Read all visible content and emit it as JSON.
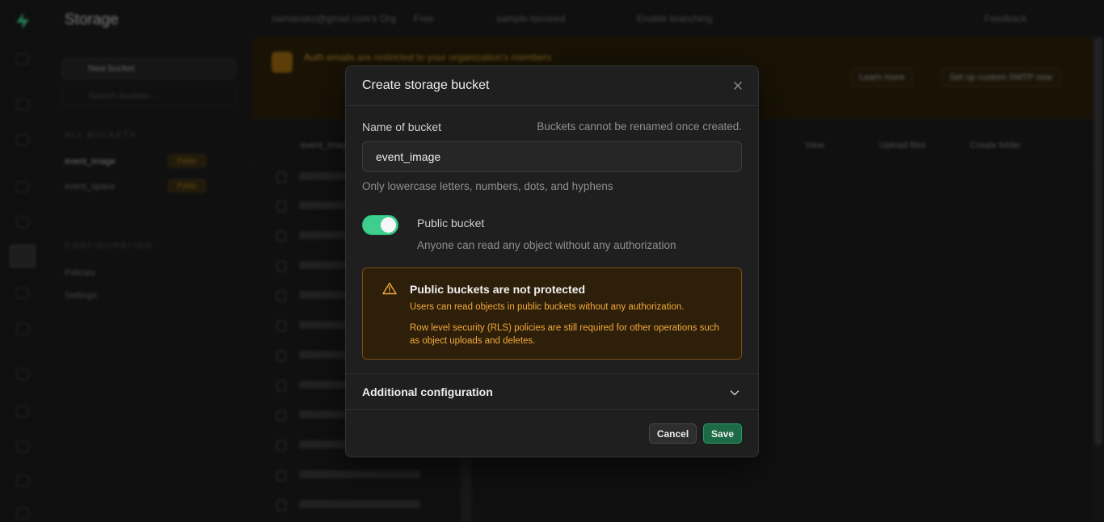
{
  "app": {
    "section_title": "Storage",
    "sidebar": {
      "new_bucket_label": "New bucket",
      "search_placeholder": "Search buckets...",
      "all_buckets_heading": "ALL BUCKETS",
      "buckets": [
        {
          "name": "event_image",
          "badge": "Public"
        },
        {
          "name": "event_space",
          "badge": "Public"
        }
      ],
      "configuration_heading": "CONFIGURATION",
      "config_items": [
        "Policies",
        "Settings"
      ]
    },
    "topbar": {
      "org": "namanaks@gmail.com's Org",
      "plan": "Free",
      "project": "sample-taxoeed",
      "branching": "Enable branching",
      "feedback": "Feedback"
    },
    "banner": {
      "title": "Auth emails are restricted to your organization's members",
      "learn_more": "Learn more",
      "smtp_button": "Set up custom SMTP now"
    },
    "files_toolbar": {
      "bucket_column": "event_image",
      "view": "View",
      "upload": "Upload files",
      "create_folder": "Create folder"
    }
  },
  "modal": {
    "title": "Create storage bucket",
    "name_label": "Name of bucket",
    "name_note": "Buckets cannot be renamed once created.",
    "name_value": "event_image",
    "name_hint": "Only lowercase letters, numbers, dots, and hyphens",
    "public_toggle": {
      "label": "Public bucket",
      "description": "Anyone can read any object without any authorization",
      "enabled": true
    },
    "warning": {
      "title": "Public buckets are not protected",
      "line1": "Users can read objects in public buckets without any authorization.",
      "line2": "Row level security (RLS) policies are still required for other operations such as object uploads and deletes."
    },
    "additional_config_label": "Additional configuration",
    "cancel_label": "Cancel",
    "save_label": "Save"
  },
  "colors": {
    "accent_green": "#3ecf8e",
    "save_green": "#1c6b46",
    "warning_orange": "#f2a93a",
    "warning_bg": "#2e1f0a",
    "modal_bg": "#1f1f1f"
  },
  "icons": [
    "supabase-logo-icon",
    "close-icon",
    "warning-triangle-icon",
    "chevron-down-icon",
    "file-icon"
  ]
}
